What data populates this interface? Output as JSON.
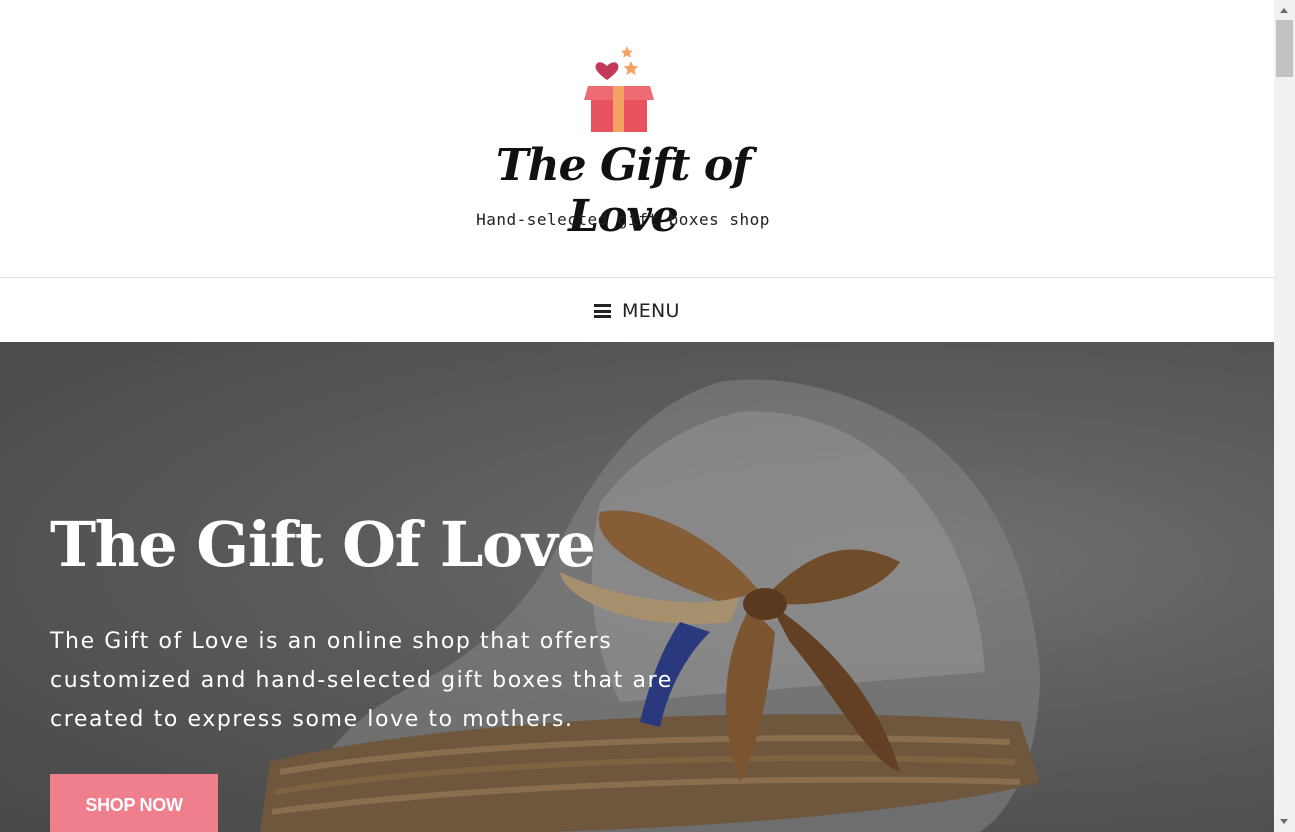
{
  "header": {
    "logo_title": "The Gift of Love",
    "logo_tagline": "Hand-selected gift boxes shop"
  },
  "nav": {
    "menu_icon": "hamburger-icon",
    "menu_label": "MENU"
  },
  "hero": {
    "title": "The Gift Of Love",
    "text": "The Gift of Love is an online shop that offers customized and hand-selected gift boxes that are created to express some love to mothers.",
    "button_label": "SHOP NOW",
    "image": "gift-basket-with-ribbon"
  },
  "colors": {
    "accent": "#f07f8d",
    "logo_box": "#ef6b73",
    "logo_heart": "#c2395a",
    "logo_stars": "#f4a261",
    "text_dark": "#222222"
  }
}
